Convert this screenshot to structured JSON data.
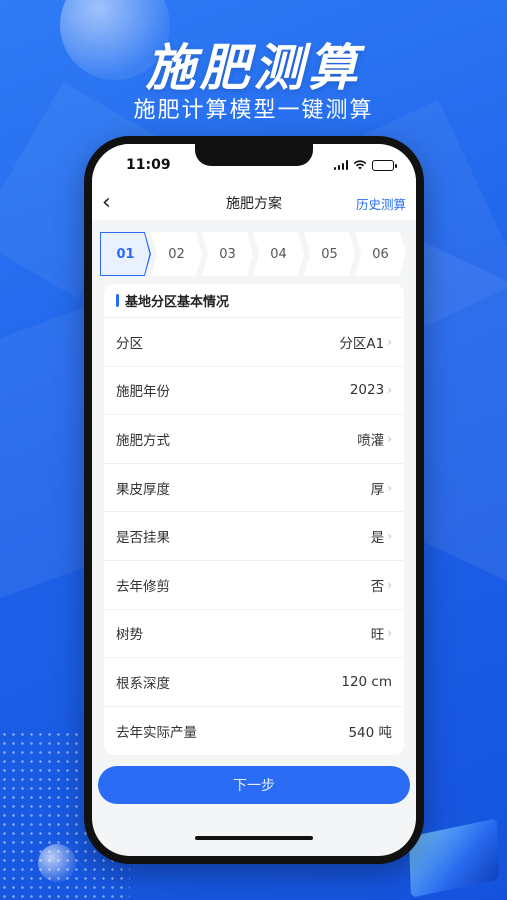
{
  "promo": {
    "headline": "施肥测算",
    "subhead": "施肥计算模型一键测算"
  },
  "status": {
    "time": "11:09"
  },
  "navbar": {
    "title": "施肥方案",
    "history": "历史测算"
  },
  "steps": [
    "01",
    "02",
    "03",
    "04",
    "05",
    "06"
  ],
  "card": {
    "title": "基地分区基本情况",
    "rows": [
      {
        "label": "分区",
        "value": "分区A1"
      },
      {
        "label": "施肥年份",
        "value": "2023"
      },
      {
        "label": "施肥方式",
        "value": "喷灌"
      },
      {
        "label": "果皮厚度",
        "value": "厚"
      },
      {
        "label": "是否挂果",
        "value": "是"
      },
      {
        "label": "去年修剪",
        "value": "否"
      },
      {
        "label": "树势",
        "value": "旺"
      },
      {
        "label": "根系深度",
        "value": "120 cm"
      },
      {
        "label": "去年实际产量",
        "value": "540 吨"
      }
    ]
  },
  "actions": {
    "next": "下一步"
  },
  "colors": {
    "accent": "#2a6df4",
    "background": "#1f63ea"
  }
}
